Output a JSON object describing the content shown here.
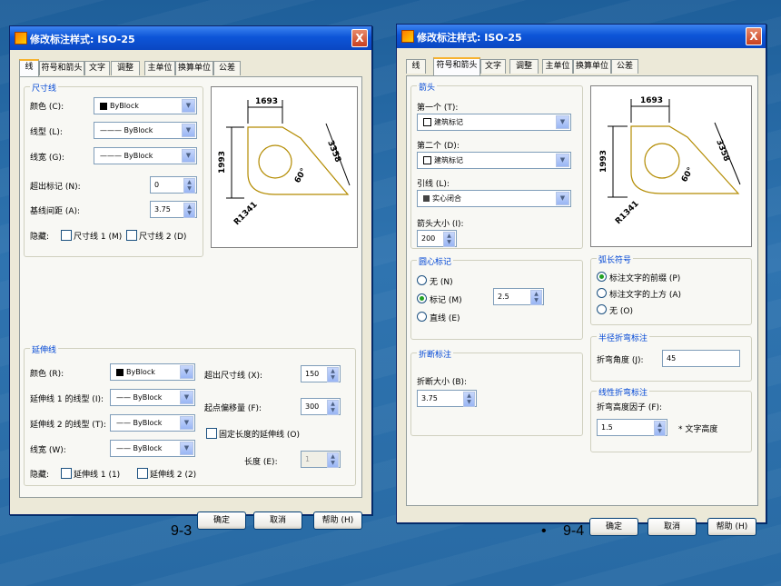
{
  "dialog1": {
    "title": "修改标注样式: ISO-25",
    "close": "X",
    "tabs": [
      "线",
      "符号和箭头",
      "文字",
      "调整",
      "主单位",
      "换算单位",
      "公差"
    ],
    "dim_lines": {
      "group_title": "尺寸线",
      "color_label": "颜色 (C):",
      "color_value": "ByBlock",
      "linetype_label": "线型 (L):",
      "linetype_value": "ByBlock",
      "lineweight_label": "线宽 (G):",
      "lineweight_value": "ByBlock",
      "extend_label": "超出标记 (N):",
      "extend_value": "0",
      "baseline_label": "基线间距 (A):",
      "baseline_value": "3.75",
      "suppress_label": "隐藏:",
      "suppress1": "尺寸线 1 (M)",
      "suppress2": "尺寸线 2 (D)"
    },
    "ext_lines": {
      "group_title": "延伸线",
      "color_label": "颜色 (R):",
      "color_value": "ByBlock",
      "lt1_label": "延伸线 1 的线型 (I):",
      "lt1_value": "ByBlock",
      "lt2_label": "延伸线 2 的线型 (T):",
      "lt2_value": "ByBlock",
      "lw_label": "线宽 (W):",
      "lw_value": "ByBlock",
      "suppress_label": "隐藏:",
      "suppress1": "延伸线 1 (1)",
      "suppress2": "延伸线 2 (2)",
      "beyond_label": "超出尺寸线 (X):",
      "beyond_value": "150",
      "offset_label": "起点偏移量 (F):",
      "offset_value": "300",
      "fixed_label": "固定长度的延伸线 (O)",
      "length_label": "长度 (E):",
      "length_value": "1"
    },
    "preview": {
      "dim_top": "1693",
      "dim_left": "1993",
      "dim_diag": "3358",
      "angle": "60°",
      "radius": "R1341"
    },
    "buttons": {
      "ok": "确定",
      "cancel": "取消",
      "help": "帮助 (H)"
    }
  },
  "dialog2": {
    "title": "修改标注样式: ISO-25",
    "close": "X",
    "tabs": [
      "线",
      "符号和箭头",
      "文字",
      "调整",
      "主单位",
      "换算单位",
      "公差"
    ],
    "arrows": {
      "group_title": "箭头",
      "first_label": "第一个 (T):",
      "first_value": "建筑标记",
      "second_label": "第二个 (D):",
      "second_value": "建筑标记",
      "leader_label": "引线 (L):",
      "leader_value": "实心闭合",
      "size_label": "箭头大小 (I):",
      "size_value": "200"
    },
    "center": {
      "group_title": "圆心标记",
      "none": "无 (N)",
      "mark": "标记 (M)",
      "line": "直线 (E)",
      "value": "2.5"
    },
    "break": {
      "group_title": "折断标注",
      "size_label": "折断大小 (B):",
      "size_value": "3.75"
    },
    "arc": {
      "group_title": "弧长符号",
      "opt1": "标注文字的前缀 (P)",
      "opt2": "标注文字的上方 (A)",
      "opt3": "无 (O)"
    },
    "radius_jog": {
      "group_title": "半径折弯标注",
      "angle_label": "折弯角度 (J):",
      "angle_value": "45"
    },
    "linear_jog": {
      "group_title": "线性折弯标注",
      "factor_label": "折弯高度因子 (F):",
      "factor_value": "1.5",
      "unit": "* 文字高度"
    },
    "preview": {
      "dim_top": "1693",
      "dim_left": "1993",
      "dim_diag": "3358",
      "angle": "60°",
      "radius": "R1341"
    },
    "buttons": {
      "ok": "确定",
      "cancel": "取消",
      "help": "帮助 (H)"
    }
  },
  "captions": {
    "left": "9-3",
    "bullet": "•",
    "right": "9-4"
  }
}
